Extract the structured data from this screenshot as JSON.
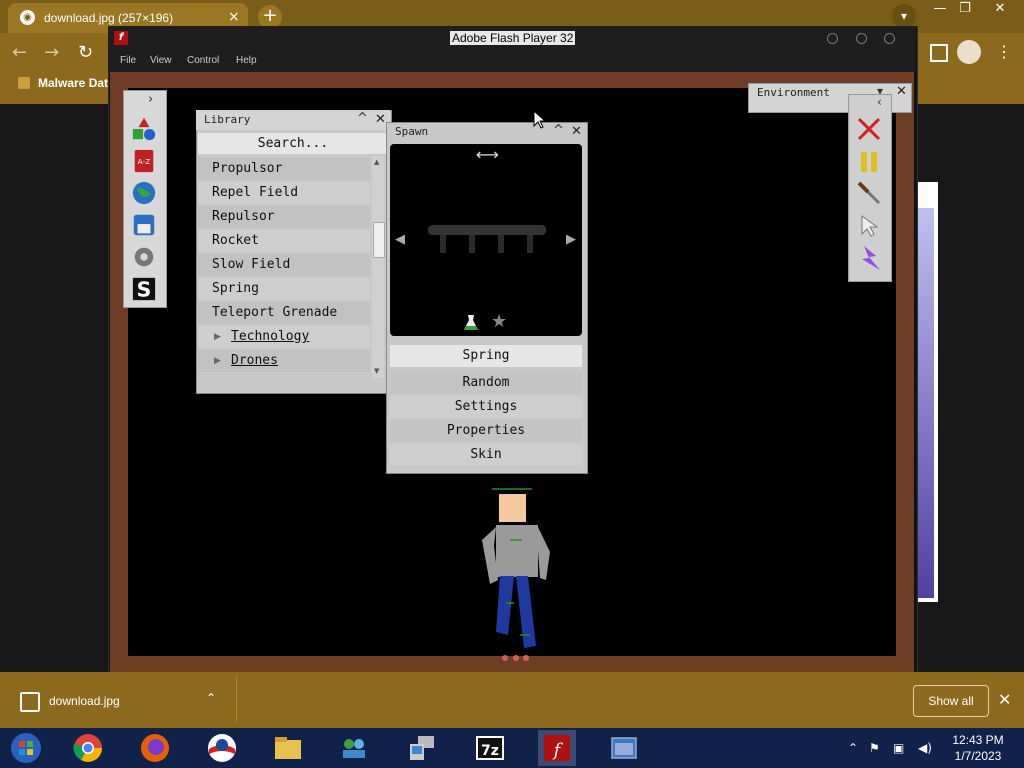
{
  "browser": {
    "tab_title": "download.jpg (257×196)",
    "tab_close": "×",
    "new_tab": "+",
    "bookmark": "Malware Data",
    "window_controls": [
      "—",
      "❐",
      "✕"
    ],
    "nav": {
      "back": "←",
      "forward": "→",
      "reload": "↻"
    }
  },
  "flash": {
    "title": "Adobe Flash Player 32",
    "logo": "f",
    "menu": [
      "File",
      "View",
      "Control",
      "Help"
    ]
  },
  "library": {
    "title": "Library",
    "search_placeholder": "Search...",
    "items": [
      "Propulsor",
      "Repel Field",
      "Repulsor",
      "Rocket",
      "Slow Field",
      "Spring",
      "Teleport Grenade"
    ],
    "folders": [
      "Technology",
      "Drones"
    ]
  },
  "spawn": {
    "title": "Spawn",
    "selected": "Spring",
    "buttons": [
      "Random",
      "Settings",
      "Properties",
      "Skin"
    ]
  },
  "environment": {
    "title": "Environment"
  },
  "panel_controls": {
    "minimize": "^",
    "close": "✕"
  },
  "download": {
    "filename": "download.jpg",
    "show_all": "Show all",
    "close": "✕"
  },
  "clock": {
    "time": "12:43 PM",
    "date": "1/7/2023"
  },
  "icons": [
    "shapes-icon",
    "az-icon",
    "globe-icon",
    "save-icon",
    "gear-icon",
    "s-icon",
    "delete-icon",
    "pause-icon",
    "knife-icon",
    "cursor-icon",
    "lightning-icon"
  ]
}
